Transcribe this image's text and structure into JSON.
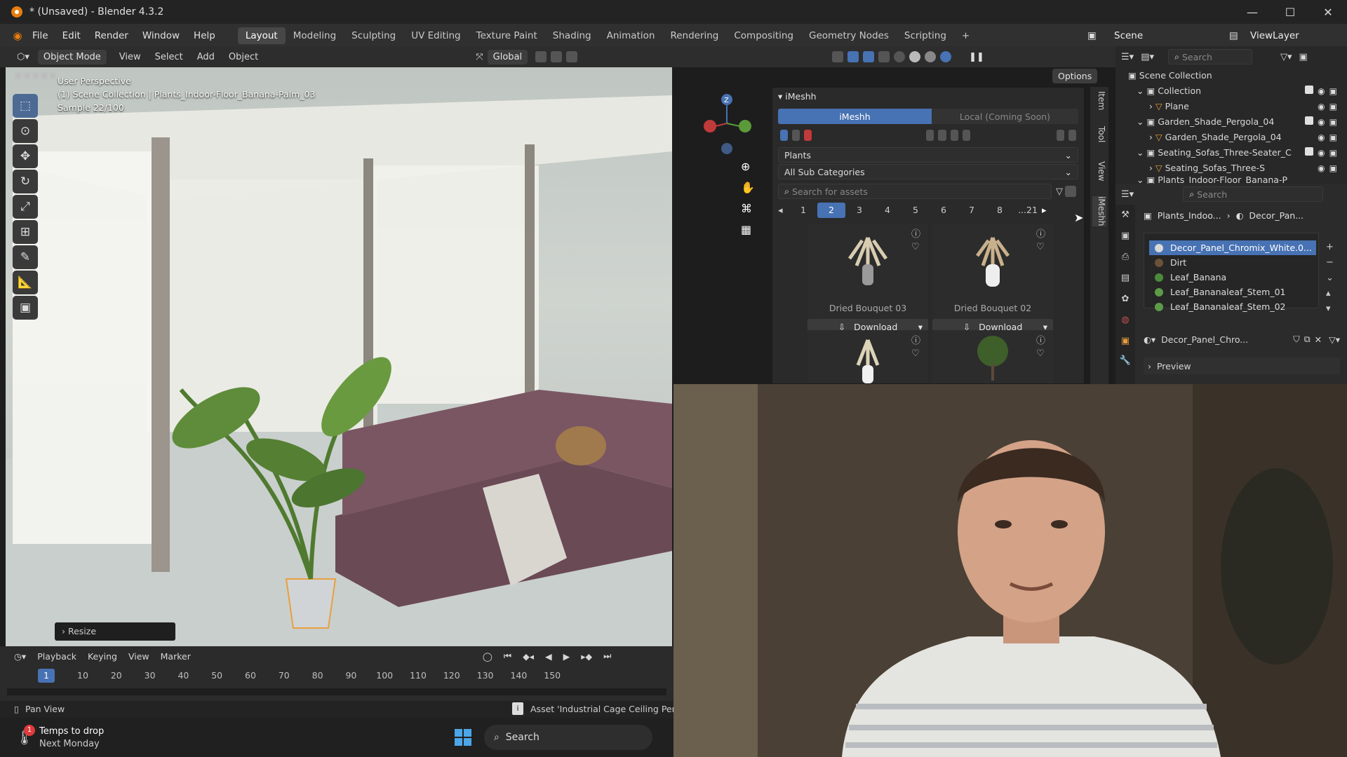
{
  "window": {
    "title": "* (Unsaved) - Blender 4.3.2",
    "minimize": "—",
    "maximize": "☐",
    "close": "✕"
  },
  "menu": [
    "File",
    "Edit",
    "Render",
    "Window",
    "Help"
  ],
  "workspaces": [
    "Layout",
    "Modeling",
    "Sculpting",
    "UV Editing",
    "Texture Paint",
    "Shading",
    "Animation",
    "Rendering",
    "Compositing",
    "Geometry Nodes",
    "Scripting"
  ],
  "active_workspace": "Layout",
  "scene": {
    "label": "Scene",
    "viewlayer": "ViewLayer"
  },
  "header3d": {
    "mode": "Object Mode",
    "view": "View",
    "select": "Select",
    "add": "Add",
    "object": "Object",
    "transform": "Global",
    "options": "Options"
  },
  "viewport": {
    "perspective": "User Perspective",
    "collection": "(1) Scene Collection | Plants_Indoor-Floor_Banana-Palm_03",
    "sample": "Sample 22/100",
    "resize": "Resize"
  },
  "imeshh": {
    "panel_title": "iMeshh",
    "tab_active": "iMeshh",
    "tab_local": "Local (Coming Soon)",
    "category": "Plants",
    "subcategory": "All Sub Categories",
    "search_placeholder": "Search for assets",
    "pages": [
      "1",
      "2",
      "3",
      "4",
      "5",
      "6",
      "7",
      "8",
      "...21"
    ],
    "active_page": "2",
    "assets": [
      {
        "name": "Dried Bouquet 03",
        "button": "Download"
      },
      {
        "name": "Dried Bouquet 02",
        "button": "Download"
      },
      {
        "name": "",
        "button": ""
      },
      {
        "name": "",
        "button": ""
      }
    ]
  },
  "side_tabs": [
    "Item",
    "Tool",
    "View",
    "iMeshh"
  ],
  "outliner": {
    "search_placeholder": "Search",
    "items": [
      {
        "label": "Scene Collection",
        "depth": 0
      },
      {
        "label": "Collection",
        "depth": 1
      },
      {
        "label": "Plane",
        "depth": 2
      },
      {
        "label": "Garden_Shade_Pergola_04",
        "depth": 1
      },
      {
        "label": "Garden_Shade_Pergola_04",
        "depth": 2
      },
      {
        "label": "Seating_Sofas_Three-Seater_C",
        "depth": 1
      },
      {
        "label": "Seating_Sofas_Three-S",
        "depth": 2
      },
      {
        "label": "Plants_Indoor-Floor_Banana-P",
        "depth": 1
      }
    ]
  },
  "properties": {
    "search_placeholder": "Search",
    "breadcrumb_object": "Plants_Indoo...",
    "breadcrumb_material": "Decor_Pan...",
    "materials": [
      {
        "name": "Decor_Panel_Chromix_White.0...",
        "color": "#d8d8d8"
      },
      {
        "name": "Dirt",
        "color": "#6b5138"
      },
      {
        "name": "Leaf_Banana",
        "color": "#4a8a3a"
      },
      {
        "name": "Leaf_Bananaleaf_Stem_01",
        "color": "#5c9b48"
      },
      {
        "name": "Leaf_Bananaleaf_Stem_02",
        "color": "#5c9b48"
      }
    ],
    "material_slot": "Decor_Panel_Chro...",
    "preview": "Preview"
  },
  "timeline": {
    "menus": [
      "Playback",
      "Keying",
      "View",
      "Marker"
    ],
    "current_frame": "1",
    "ticks": [
      "10",
      "20",
      "30",
      "40",
      "50",
      "60",
      "70",
      "80",
      "90",
      "100",
      "110",
      "120",
      "130",
      "140",
      "150"
    ]
  },
  "status": {
    "left": "Pan View",
    "right": "Asset 'Industrial Cage Ceiling Pend"
  },
  "taskbar": {
    "weather_title": "Temps to drop",
    "weather_sub": "Next Monday",
    "badge": "1",
    "search": "Search"
  },
  "colors": {
    "accent": "#4772b3",
    "orange": "#e87d0d",
    "panel": "#2a2a2a"
  }
}
